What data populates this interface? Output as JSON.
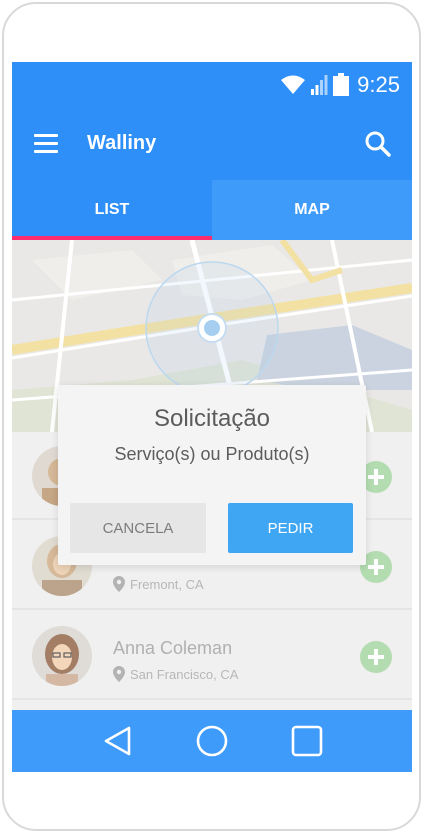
{
  "status_bar": {
    "time": "9:25"
  },
  "app_bar": {
    "title": "Walliny"
  },
  "tabs": [
    {
      "label": "LIST",
      "active": true
    },
    {
      "label": "MAP",
      "active": false
    }
  ],
  "list": [
    {
      "name": "",
      "location": ""
    },
    {
      "name": "",
      "location": "Fremont, CA"
    },
    {
      "name": "Anna Coleman",
      "location": "San Francisco, CA"
    }
  ],
  "dialog": {
    "title": "Solicitação",
    "subtitle": "Serviço(s) ou Produto(s)",
    "cancel_label": "CANCELA",
    "confirm_label": "PEDIR"
  },
  "colors": {
    "primary": "#2e8ff8",
    "tab_indicator": "#ff2d6d",
    "confirm_button": "#3fa6f4",
    "add_button": "#9fd39c"
  },
  "icons": [
    "wifi-icon",
    "signal-icon",
    "battery-icon",
    "menu-icon",
    "search-icon",
    "location-pin-icon",
    "add-icon",
    "back-icon",
    "home-icon",
    "recents-icon"
  ]
}
